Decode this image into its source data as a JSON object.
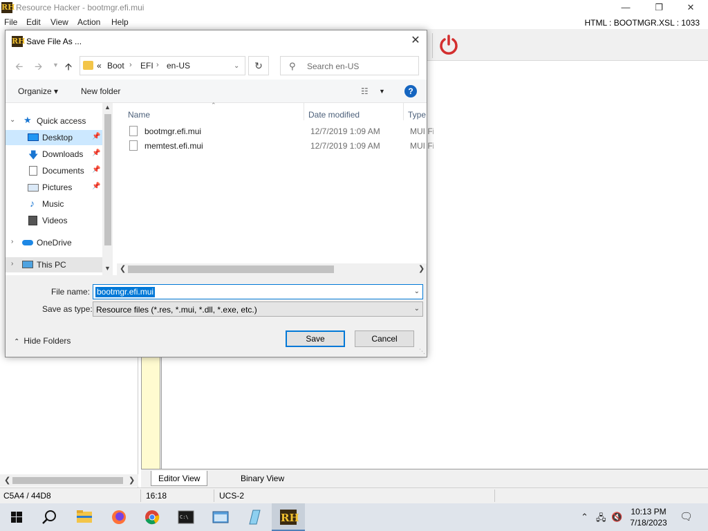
{
  "app": {
    "title": "Resource Hacker - bootmgr.efi.mui",
    "logo_text": "RH",
    "menu": [
      "File",
      "Edit",
      "View",
      "Action",
      "Help"
    ],
    "html_info": "HTML : BOOTMGR.XSL : 1033",
    "view_tabs": [
      "Editor View",
      "Binary View"
    ],
    "status": {
      "offset": "C5A4 / 44D8",
      "position": "16:18",
      "encoding": "UCS-2"
    },
    "power_color": "#d32f2f"
  },
  "dialog": {
    "title": "Save File As ...",
    "address": {
      "overflow": "«",
      "segments": [
        "Boot",
        "EFI",
        "en-US"
      ]
    },
    "search_placeholder": "Search en-US",
    "organize_label": "Organize ▾",
    "new_folder_label": "New folder",
    "nav": {
      "quick_access": "Quick access",
      "items": [
        "Desktop",
        "Downloads",
        "Documents",
        "Pictures",
        "Music",
        "Videos"
      ],
      "onedrive": "OneDrive",
      "this_pc": "This PC"
    },
    "columns": {
      "name": "Name",
      "date": "Date modified",
      "type": "Type"
    },
    "files": [
      {
        "name": "bootmgr.efi.mui",
        "date": "12/7/2019 1:09 AM",
        "type": "MUI File"
      },
      {
        "name": "memtest.efi.mui",
        "date": "12/7/2019 1:09 AM",
        "type": "MUI File"
      }
    ],
    "file_name_label": "File name:",
    "file_name_value": "bootmgr.efi.mui",
    "save_type_label": "Save as type:",
    "save_type_value": "Resource files (*.res, *.mui, *.dll, *.exe, etc.)",
    "hide_folders_label": "Hide Folders",
    "save_label": "Save",
    "cancel_label": "Cancel"
  },
  "taskbar": {
    "time": "10:13 PM",
    "date": "7/18/2023"
  }
}
